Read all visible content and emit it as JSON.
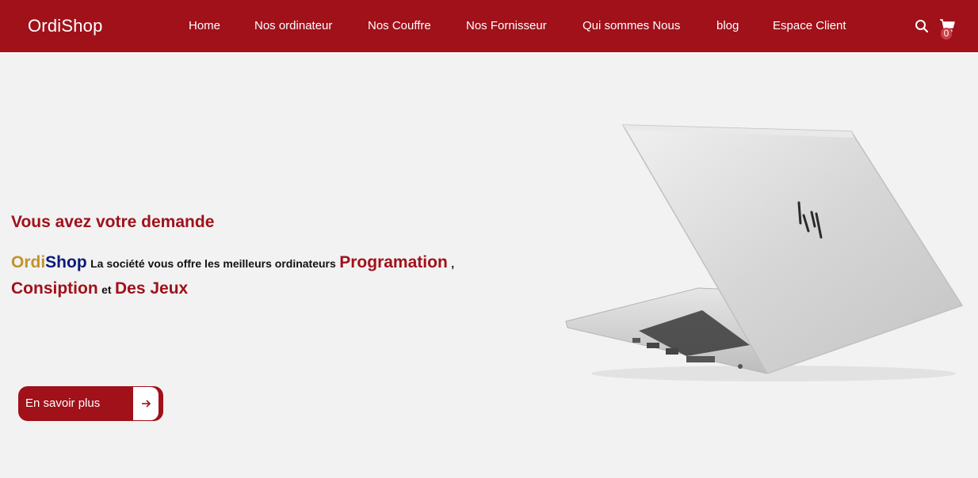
{
  "brand": "OrdiShop",
  "nav": {
    "items": [
      {
        "label": "Home"
      },
      {
        "label": "Nos ordinateur"
      },
      {
        "label": "Nos Couffre"
      },
      {
        "label": "Nos Fornisseur"
      },
      {
        "label": "Qui sommes Nous"
      },
      {
        "label": "blog"
      },
      {
        "label": "Espace Client"
      }
    ],
    "cart_count": "0",
    "icons": [
      "search-icon",
      "cart-icon"
    ]
  },
  "hero": {
    "title": "Vous avez votre demande",
    "brand_part1": "Ordi",
    "brand_part2": "Shop",
    "intro": "La société vous offre les meilleurs ordinateurs",
    "item1": "Programation",
    "comma": ",",
    "item2": "Consiption",
    "et": "et",
    "item3": "Des Jeux",
    "cta_label": "En savoir plus"
  },
  "colors": {
    "primary": "#a0111a",
    "background": "#f2f2f2",
    "brand_gold": "#c2922a",
    "brand_navy": "#0d1a7a"
  }
}
